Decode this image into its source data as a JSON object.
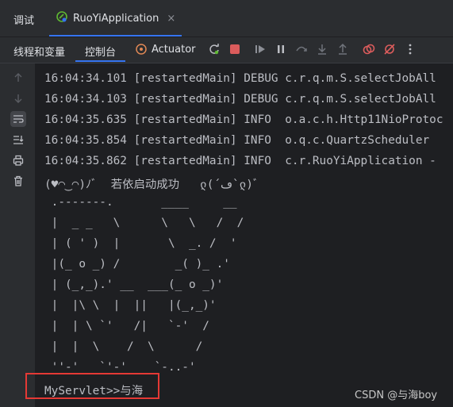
{
  "tabs": {
    "debug_label": "调试",
    "app_label": "RuoYiApplication",
    "close_glyph": "×"
  },
  "toolbar": {
    "threads_label": "线程和变量",
    "console_label": "控制台",
    "actuator_label": "Actuator"
  },
  "console": {
    "lines": [
      "16:04:34.101 [restartedMain] DEBUG c.r.q.m.S.selectJobAll",
      "16:04:34.103 [restartedMain] DEBUG c.r.q.m.S.selectJobAll",
      "16:04:35.635 [restartedMain] INFO  o.a.c.h.Http11NioProtoc",
      "16:04:35.854 [restartedMain] INFO  o.q.c.QuartzScheduler",
      "16:04:35.862 [restartedMain] INFO  c.r.RuoYiApplication -",
      "(♥◠‿◠)ﾉﾞ  若依启动成功   ლ(´ڡ`ლ)ﾞ",
      " .-------.       ____     __",
      " |  _ _   \\      \\   \\   /  /",
      " | ( ' )  |       \\  _. /  '",
      " |(_ o _) /        _( )_ .'",
      " | (_,_).' __  ___(_ o _)'",
      " |  |\\ \\  |  ||   |(_,_)'",
      " |  | \\ `'   /|   `-'  /",
      " |  |  \\    /  \\      /",
      " ''-'   `'-'    `-..-'",
      "MyServlet>>与海"
    ]
  },
  "watermark": "CSDN @与海boy",
  "colors": {
    "accent": "#3574f0",
    "stop": "#db5c5c",
    "highlight_box": "#e53935"
  }
}
